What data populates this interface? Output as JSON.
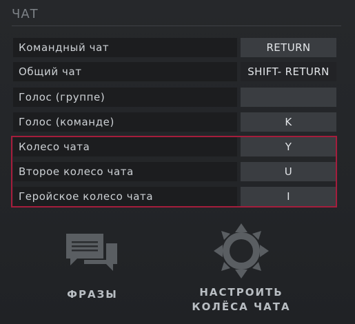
{
  "section": {
    "title": "ЧАТ"
  },
  "rows": [
    {
      "label": "Командный чат",
      "key": "RETURN"
    },
    {
      "label": "Общий чат",
      "key": "SHIFT- RETURN"
    },
    {
      "label": "Голос (группе)",
      "key": ""
    },
    {
      "label": "Голос (команде)",
      "key": "K"
    },
    {
      "label": "Колесо чата",
      "key": "Y"
    },
    {
      "label": "Второе колесо чата",
      "key": "U"
    },
    {
      "label": "Геройское колесо чата",
      "key": "I"
    }
  ],
  "buttons": {
    "phrases": {
      "label": "ФРАЗЫ",
      "icon": "chat-bubbles-icon"
    },
    "configure_wheels": {
      "line1": "НАСТРОИТЬ",
      "line2": "КОЛЁСА ЧАТА",
      "icon": "chat-wheel-icon"
    }
  },
  "colors": {
    "highlight": "#a51d3c",
    "key_background": "#3a3d41",
    "label_background": "#1c1d1f"
  }
}
